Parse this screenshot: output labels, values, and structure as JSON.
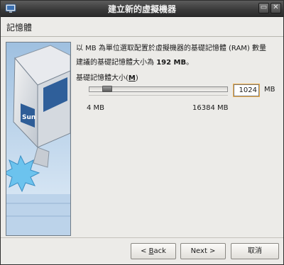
{
  "window": {
    "title": "建立新的虛擬機器",
    "restore_glyph": "▭",
    "close_glyph": "✕",
    "icon": "virtualbox-app-icon"
  },
  "page": {
    "heading": "記憶體"
  },
  "description": {
    "line1": "以 MB 為單位選取配置於虛擬機器的基礎記憶體 (RAM) 數量",
    "line2_prefix": "建議的基礎記憶體大小為 ",
    "line2_value": "192 MB",
    "line2_suffix": "。"
  },
  "memory": {
    "label_prefix": "基礎記憶體大小(",
    "label_mnemonic": "M",
    "label_suffix": ")",
    "value": "1024",
    "unit": "MB",
    "min_label": "4  MB",
    "max_label": "16384  MB",
    "min_value": 4,
    "max_value": 16384,
    "current_value": 1024
  },
  "buttons": {
    "back_prefix": "< ",
    "back_mnemonic": "B",
    "back_suffix": "ack",
    "next": "Next >",
    "cancel": "取消"
  },
  "colors": {
    "titlebar": "#3b3b3b",
    "focus_outline": "#f2b14a",
    "dialog_bg": "#ecebe8"
  },
  "side_image": {
    "brand_text": "Sun"
  }
}
